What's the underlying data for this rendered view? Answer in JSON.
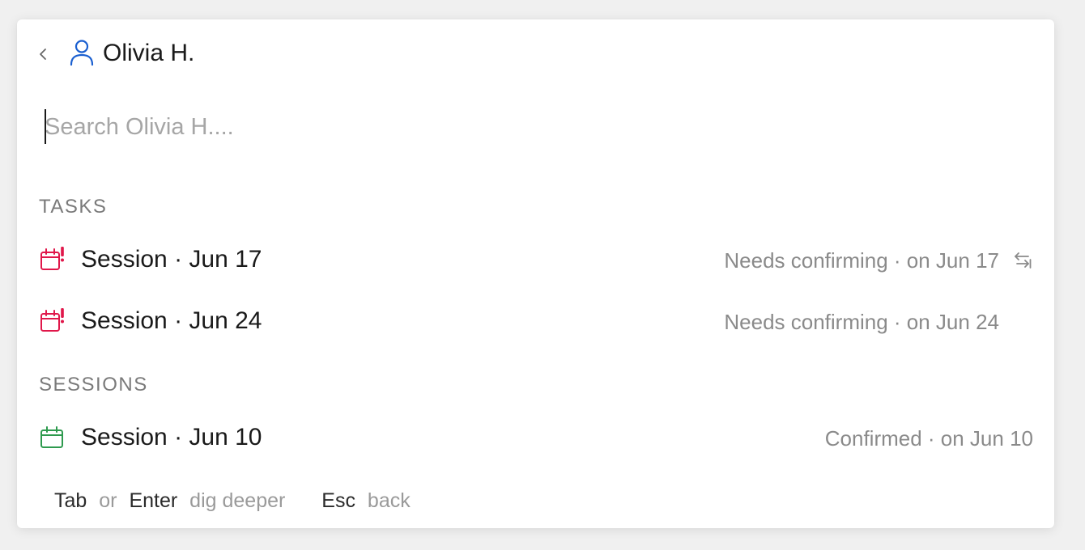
{
  "header": {
    "title": "Olivia H.",
    "back_icon": "chevron-left-icon",
    "person_icon": "person-icon",
    "accent_color": "#1a5fd0"
  },
  "search": {
    "placeholder": "Search Olivia H....",
    "value": ""
  },
  "sections": {
    "tasks": {
      "label": "TASKS",
      "items": [
        {
          "icon": "calendar-alert-icon",
          "label": "Session · Jun 17",
          "meta": "Needs confirming · on Jun 17",
          "has_swap_icon": true
        },
        {
          "icon": "calendar-alert-icon",
          "label": "Session · Jun 24",
          "meta": "Needs confirming · on Jun 24",
          "has_swap_icon": false
        }
      ]
    },
    "sessions": {
      "label": "SESSIONS",
      "items": [
        {
          "icon": "calendar-icon",
          "label": "Session · Jun 10",
          "meta": "Confirmed · on Jun 10"
        }
      ]
    }
  },
  "footer": {
    "key1": "Tab",
    "or": "or",
    "key2": "Enter",
    "action1": "dig deeper",
    "key3": "Esc",
    "action2": "back"
  },
  "colors": {
    "alert_red": "#e0174a",
    "confirmed_green": "#2e9a4e",
    "muted_text": "#8a8a8a"
  }
}
